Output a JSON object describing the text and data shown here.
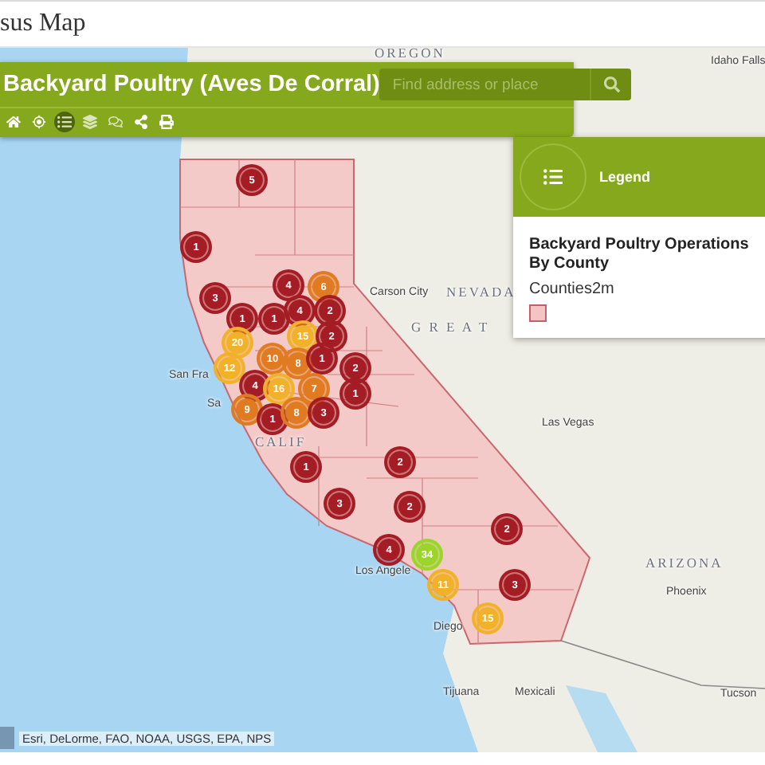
{
  "page": {
    "title": "sus Map"
  },
  "app_panel": {
    "title": "Backyard Poultry (Aves De Corral)",
    "search": {
      "placeholder": "Find address or place"
    },
    "tools": [
      {
        "kind": "home",
        "selected": false
      },
      {
        "kind": "locate",
        "selected": false
      },
      {
        "kind": "legend",
        "selected": true
      },
      {
        "kind": "layers",
        "selected": false
      },
      {
        "kind": "basemap",
        "selected": false
      },
      {
        "kind": "share",
        "selected": false
      },
      {
        "kind": "print",
        "selected": false
      }
    ]
  },
  "legend": {
    "title": "Legend",
    "layer_title": "Backyard Poultry Operations By County",
    "sublayer": "Counties2m"
  },
  "map_labels": [
    {
      "text": "OREGON",
      "kind": "state"
    },
    {
      "text": "Idaho Falls",
      "kind": "city"
    },
    {
      "text": "Carson City",
      "kind": "city"
    },
    {
      "text": "NEVADA",
      "kind": "state"
    },
    {
      "text": "G R E A T",
      "kind": "state"
    },
    {
      "text": "San Fra",
      "kind": "city"
    },
    {
      "text": "Sa",
      "kind": "city"
    },
    {
      "text": "CALIF",
      "kind": "state"
    },
    {
      "text": "Las Vegas",
      "kind": "city"
    },
    {
      "text": "ARIZONA",
      "kind": "state"
    },
    {
      "text": "Phoenix",
      "kind": "city"
    },
    {
      "text": "Los Angele",
      "kind": "city"
    },
    {
      "text": "Diego",
      "kind": "city"
    },
    {
      "text": "Tijuana",
      "kind": "city"
    },
    {
      "text": "Mexicali",
      "kind": "city"
    },
    {
      "text": "Tucson",
      "kind": "city"
    }
  ],
  "clusters": [
    {
      "count": "5",
      "color": "#a51d24"
    },
    {
      "count": "1",
      "color": "#a51d24"
    },
    {
      "count": "3",
      "color": "#a51d24"
    },
    {
      "count": "4",
      "color": "#a51d24"
    },
    {
      "count": "6",
      "color": "#e07b22"
    },
    {
      "count": "1",
      "color": "#a51d24"
    },
    {
      "count": "1",
      "color": "#a51d24"
    },
    {
      "count": "4",
      "color": "#a51d24"
    },
    {
      "count": "2",
      "color": "#a51d24"
    },
    {
      "count": "20",
      "color": "#f2b12a"
    },
    {
      "count": "15",
      "color": "#f2b12a"
    },
    {
      "count": "2",
      "color": "#a51d24"
    },
    {
      "count": "12",
      "color": "#f2b12a"
    },
    {
      "count": "10",
      "color": "#e07b22"
    },
    {
      "count": "8",
      "color": "#e07b22"
    },
    {
      "count": "1",
      "color": "#a51d24"
    },
    {
      "count": "2",
      "color": "#a51d24"
    },
    {
      "count": "4",
      "color": "#a51d24"
    },
    {
      "count": "16",
      "color": "#f2b12a"
    },
    {
      "count": "7",
      "color": "#e07b22"
    },
    {
      "count": "1",
      "color": "#a51d24"
    },
    {
      "count": "9",
      "color": "#e07b22"
    },
    {
      "count": "1",
      "color": "#a51d24"
    },
    {
      "count": "8",
      "color": "#e07b22"
    },
    {
      "count": "3",
      "color": "#a51d24"
    },
    {
      "count": "1",
      "color": "#a51d24"
    },
    {
      "count": "2",
      "color": "#a51d24"
    },
    {
      "count": "3",
      "color": "#a51d24"
    },
    {
      "count": "2",
      "color": "#a51d24"
    },
    {
      "count": "2",
      "color": "#a51d24"
    },
    {
      "count": "4",
      "color": "#a51d24"
    },
    {
      "count": "34",
      "color": "#9ad62a"
    },
    {
      "count": "11",
      "color": "#f2b12a"
    },
    {
      "count": "3",
      "color": "#a51d24"
    },
    {
      "count": "15",
      "color": "#f2b12a"
    }
  ],
  "attribution": "Esri, DeLorme, FAO, NOAA, USGS, EPA, NPS"
}
